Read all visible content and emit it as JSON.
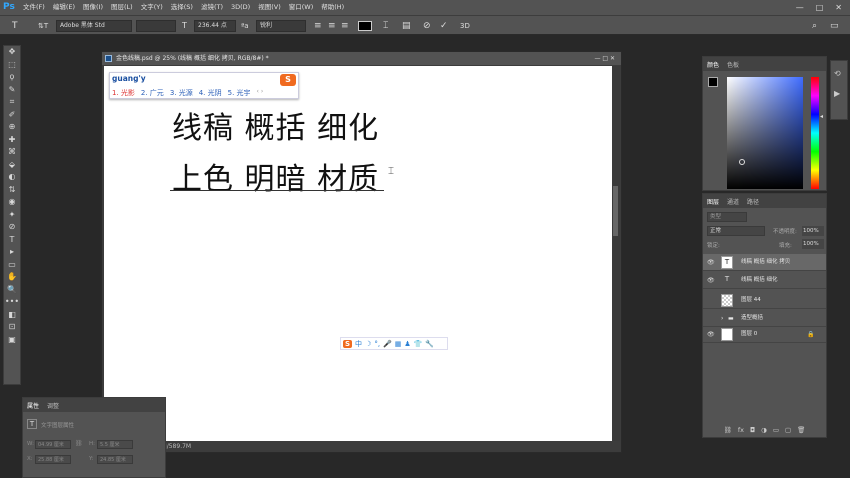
{
  "menubar": {
    "logo": "Ps",
    "items": [
      "文件(F)",
      "编辑(E)",
      "图像(I)",
      "图层(L)",
      "文字(Y)",
      "选择(S)",
      "滤镜(T)",
      "3D(D)",
      "视图(V)",
      "窗口(W)",
      "帮助(H)"
    ],
    "win_min": "—",
    "win_max": "□",
    "win_close": "✕"
  },
  "options": {
    "tool_glyph": "T",
    "orient_glyph": "⇅T",
    "font_family": "Adobe 黑体 Std",
    "font_style": "",
    "size_glyph": "T",
    "font_size": "236.44 点",
    "aa_glyph": "ªa",
    "anti_alias": "锐利",
    "cancel_glyph": "⊘",
    "commit_glyph": "✓",
    "threed_label": "3D",
    "search_glyph": "⌕",
    "workspace_glyph": "▭"
  },
  "document": {
    "title": "金色线稿.psd @ 25% (线稿  概括  细化    拷贝, RGB/8#) *",
    "line1": "线稿  概括  细化",
    "line2": "上色  明暗  材质",
    "status": "6.4M/589.7M",
    "win_controls": "—  □  ✕"
  },
  "ime": {
    "input": "guang'y",
    "candidates": [
      "1. 光影",
      "2. 广元",
      "3. 光源",
      "4. 光阴",
      "5. 光宇"
    ],
    "logo": "S",
    "nav": "‹ ›",
    "bar_items": [
      "S",
      "中",
      "☽",
      "°,",
      "🎤",
      "▦",
      "♟",
      "👕",
      "🔧"
    ]
  },
  "color_panel": {
    "tabs": [
      "颜色",
      "色板"
    ]
  },
  "layers_panel": {
    "tabs": [
      "图层",
      "通道",
      "路径"
    ],
    "filter_placeholder": "类型",
    "blend_mode": "正常",
    "opacity_label": "不透明度:",
    "opacity": "100%",
    "lock_label": "锁定:",
    "fill_label": "填充:",
    "fill": "100%",
    "layers": [
      {
        "name": "线稿  概括  细化    拷贝",
        "type": "T",
        "visible": true,
        "selected": true
      },
      {
        "name": "线稿  概括  细化",
        "type": "T",
        "visible": true,
        "selected": false
      },
      {
        "name": "图层 44",
        "type": "checker",
        "visible": false,
        "selected": false
      },
      {
        "name": "造型概括",
        "type": "folder",
        "visible": false,
        "selected": false
      },
      {
        "name": "图层 0",
        "type": "white",
        "visible": true,
        "selected": false
      }
    ],
    "footer_icons": [
      "⛓",
      "fx",
      "◘",
      "◑",
      "▭",
      "▢",
      "🗑"
    ]
  },
  "properties_panel": {
    "tabs": [
      "属性",
      "调整"
    ],
    "title": "文字图层属性",
    "w_label": "W:",
    "w_value": "04.99 厘米",
    "h_label": "H:",
    "h_value": "5.5 厘米",
    "x_label": "X:",
    "x_value": "25.88 厘米",
    "y_label": "Y:",
    "y_value": "24.85 厘米",
    "link_glyph": "⛓"
  },
  "tools": [
    "✥",
    "⬚",
    "ϙ",
    "✎",
    "⌗",
    "✐",
    "⊕",
    "✚",
    "⌘",
    "⬙",
    "◐",
    "⇅",
    "◉",
    "✦",
    "⊘",
    "T",
    "▸",
    "▭",
    "✋",
    "🔍",
    "•••",
    "◧",
    "⊡",
    "▣"
  ]
}
